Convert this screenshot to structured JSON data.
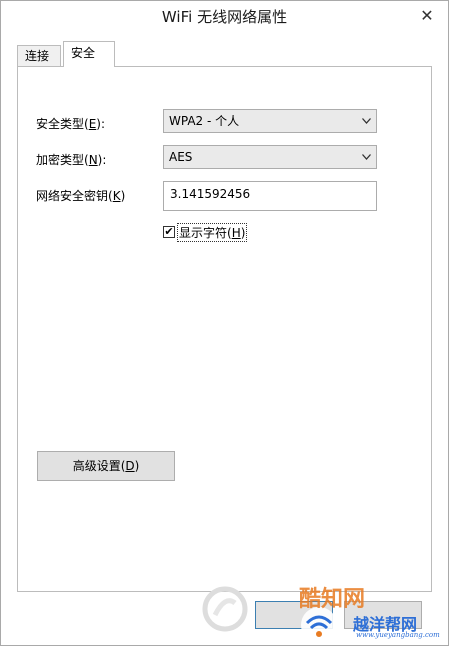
{
  "window": {
    "title": "WiFi 无线网络属性",
    "close_glyph": "✕"
  },
  "tabs": [
    {
      "label": "连接"
    },
    {
      "label": "安全"
    }
  ],
  "security": {
    "security_type_label": "安全类型(",
    "security_type_key": "E",
    "security_type_value": "WPA2 - 个人",
    "encryption_type_label": "加密类型(",
    "encryption_type_key": "N",
    "encryption_type_value": "AES",
    "network_key_label": "网络安全密钥(",
    "network_key_key": "K",
    "network_key_value": "3.141592456",
    "show_chars_label": "显示字符(",
    "show_chars_key": "H",
    "show_chars_checked": true,
    "label_close": "):",
    "label_close_plain": ")",
    "check_glyph": "✔"
  },
  "advanced_button": {
    "label": "高级设置(",
    "key": "D",
    "close": ")"
  },
  "watermark": {
    "text_top": "酷知网",
    "text_bottom": "越洋帮网",
    "url": "www.yueyangbang.com"
  }
}
